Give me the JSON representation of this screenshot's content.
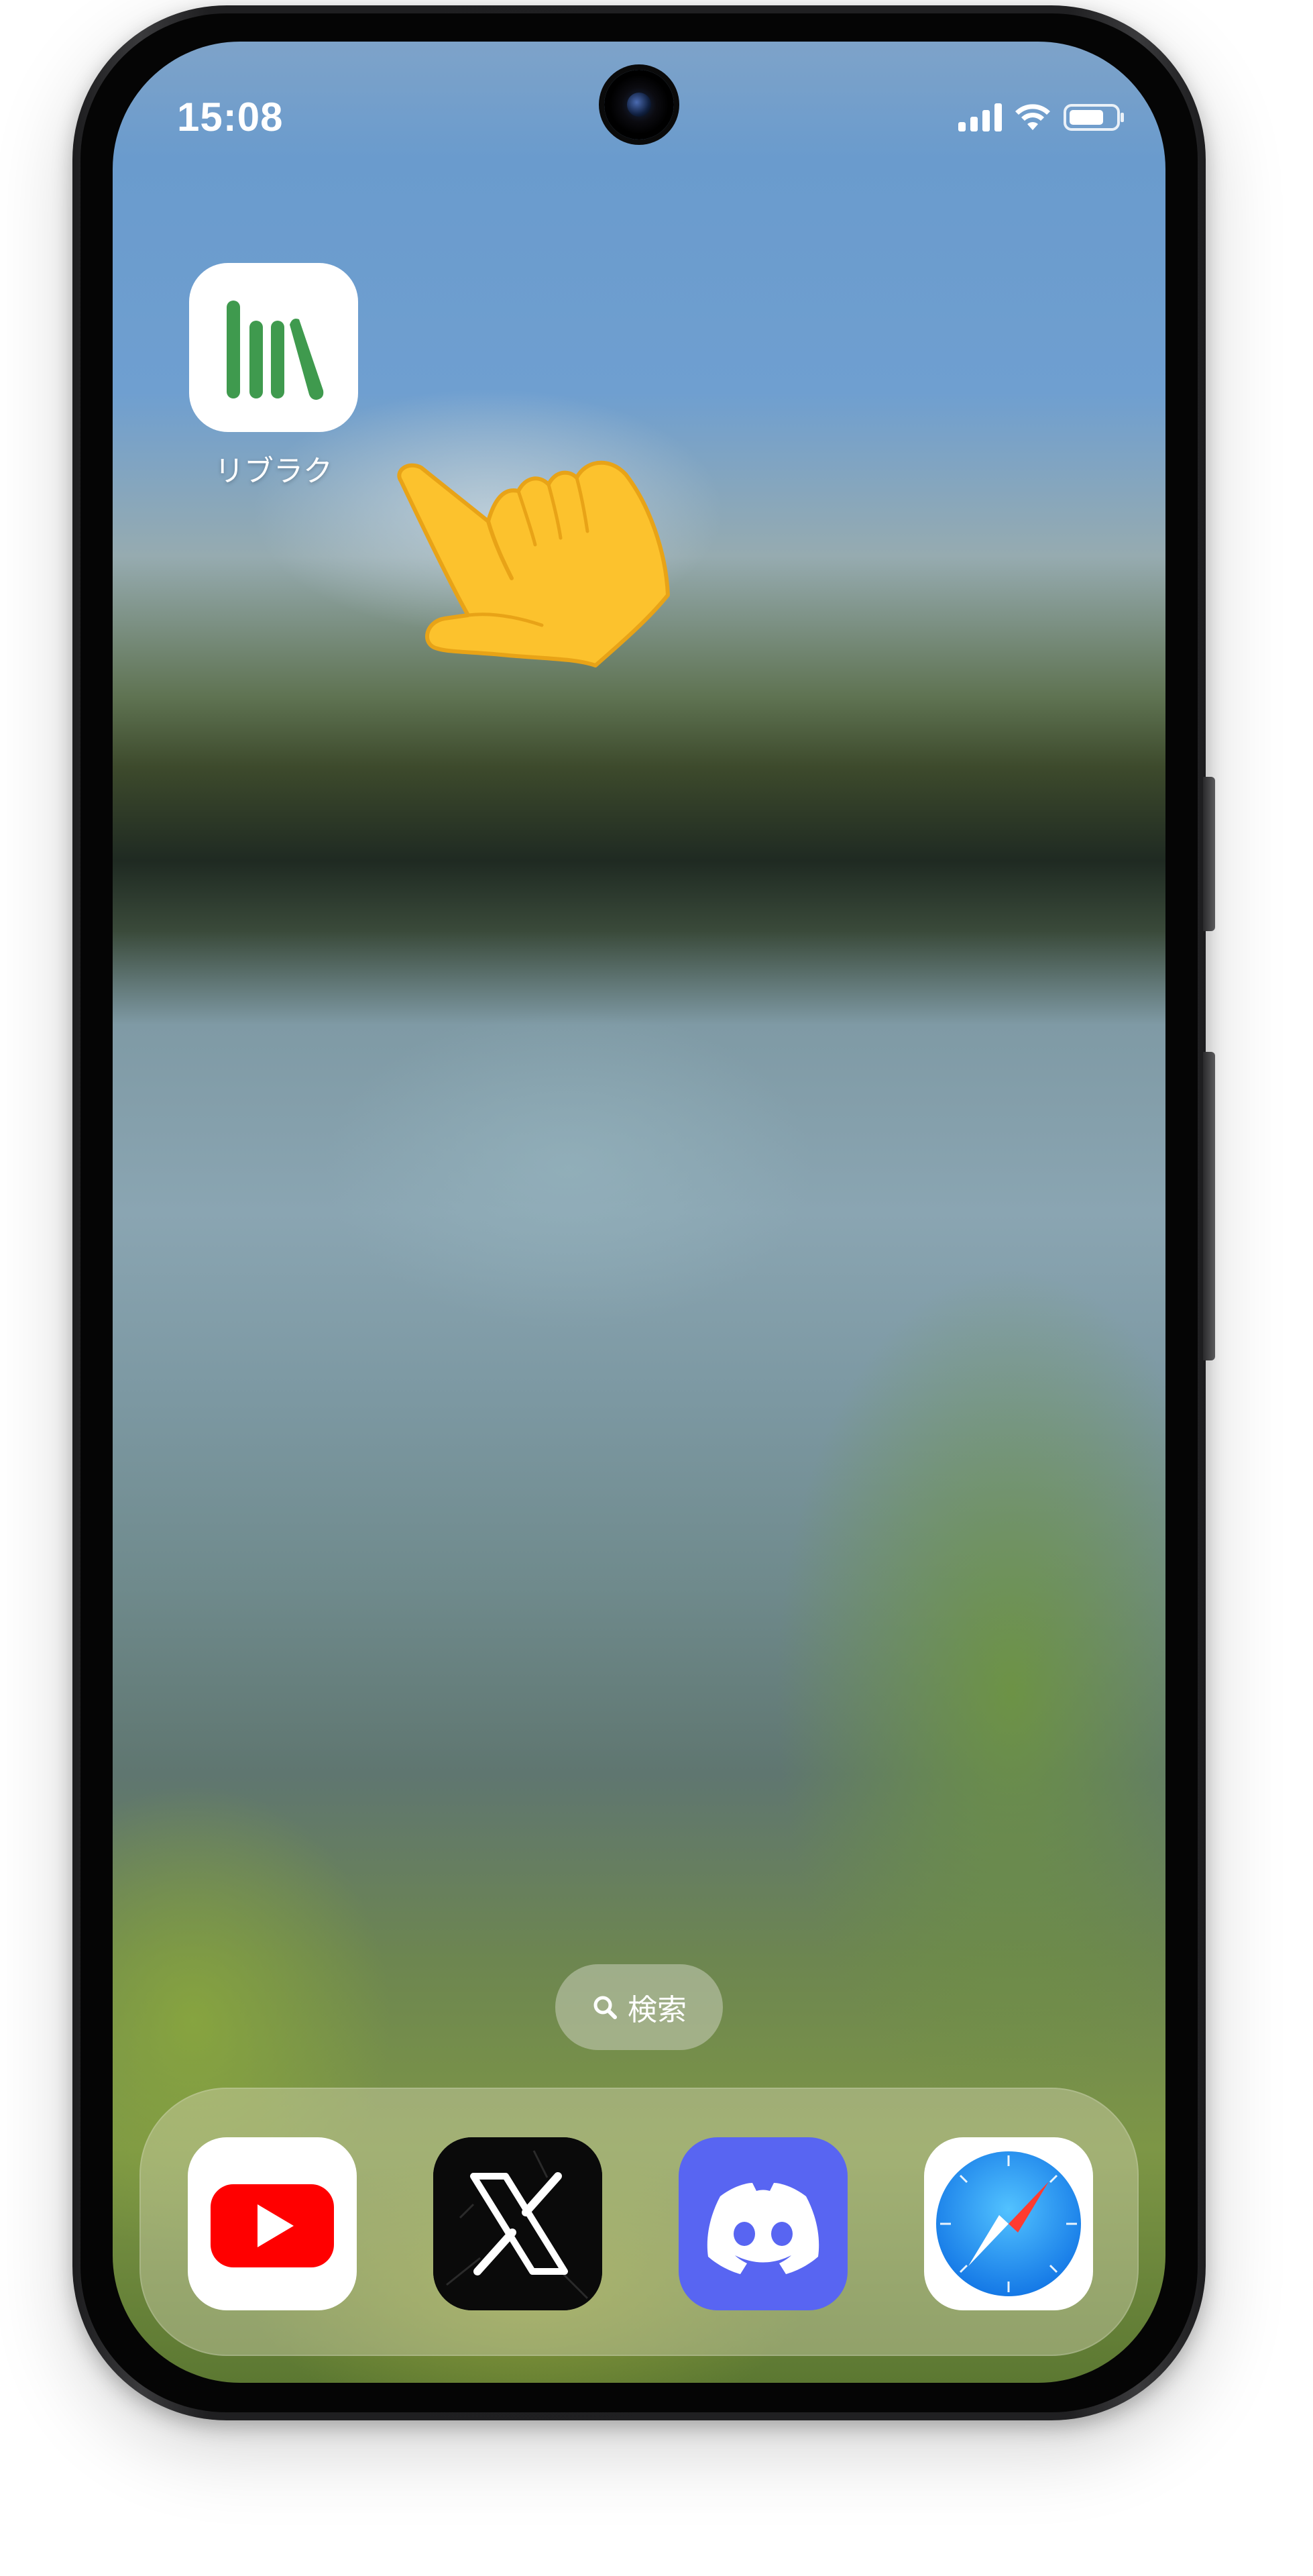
{
  "status_bar": {
    "time": "15:08"
  },
  "home_apps": [
    {
      "label": "リブラク",
      "icon": "library-books-icon"
    }
  ],
  "overlay": {
    "icon": "pointing-hand-emoji"
  },
  "search_pill": {
    "label": "検索",
    "icon": "search-icon"
  },
  "dock": {
    "apps": [
      {
        "name": "youtube",
        "icon": "youtube-icon"
      },
      {
        "name": "x",
        "icon": "x-icon"
      },
      {
        "name": "discord",
        "icon": "discord-icon"
      },
      {
        "name": "safari",
        "icon": "safari-icon"
      }
    ]
  },
  "colors": {
    "libraku_green": "#3f9a4e",
    "youtube_red": "#ff0000",
    "discord_blurple": "#5865f2",
    "safari_blue": "#1e8ef0",
    "pointer_yellow": "#fcc22d"
  }
}
